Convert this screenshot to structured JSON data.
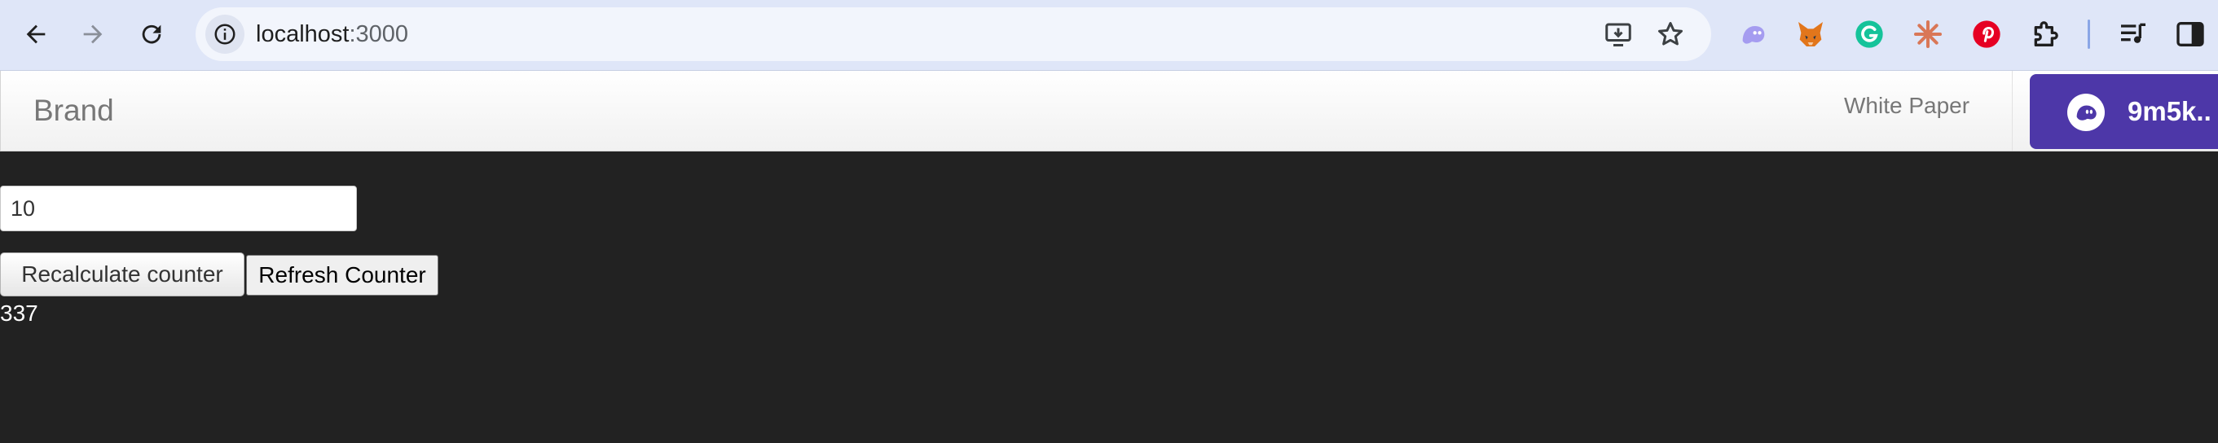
{
  "browser": {
    "url_host": "localhost",
    "url_port": ":3000",
    "icons": {
      "back": "back-arrow-icon",
      "forward": "forward-arrow-icon",
      "reload": "reload-icon",
      "site_info": "site-info-icon",
      "install": "install-app-icon",
      "bookmark": "star-icon",
      "extensions": [
        "ghost-extension-icon",
        "metamask-fox-icon",
        "grammarly-icon",
        "claude-star-icon",
        "pinterest-icon",
        "puzzle-extensions-icon",
        "media-controls-icon",
        "side-panel-icon"
      ]
    }
  },
  "navbar": {
    "brand": "Brand",
    "links": [
      "White Paper"
    ],
    "wallet_button_label": "9m5k..",
    "wallet_color": "#4d37a8"
  },
  "main": {
    "input_value": "10",
    "recalculate_label": "Recalculate counter",
    "refresh_label": "Refresh Counter",
    "counter_value": "337"
  },
  "colors": {
    "page_background": "#222222",
    "chrome_background": "#dfe6f8"
  }
}
